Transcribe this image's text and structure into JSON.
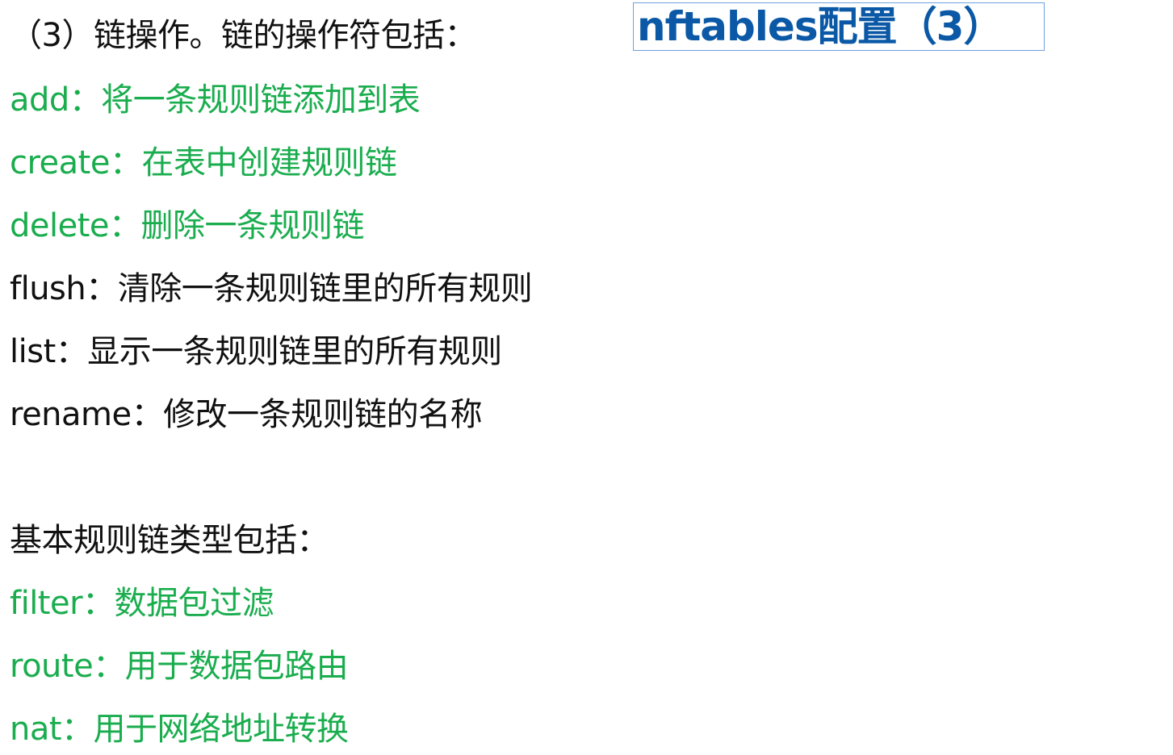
{
  "title": "nftables配置（3）",
  "lines": [
    {
      "text": "（3）链操作。链的操作符包括：",
      "color": "black"
    },
    {
      "text": "add：将一条规则链添加到表",
      "color": "green"
    },
    {
      "text": "create：在表中创建规则链",
      "color": "green"
    },
    {
      "text": "delete：删除一条规则链",
      "color": "green"
    },
    {
      "text": "flush：清除一条规则链里的所有规则",
      "color": "black"
    },
    {
      "text": "list：显示一条规则链里的所有规则",
      "color": "black"
    },
    {
      "text": "rename：修改一条规则链的名称",
      "color": "black"
    },
    {
      "text": "基本规则链类型包括：",
      "color": "black"
    },
    {
      "text": "filter：数据包过滤",
      "color": "green"
    },
    {
      "text": "route：用于数据包路由",
      "color": "green"
    },
    {
      "text": "nat：用于网络地址转换",
      "color": "green"
    }
  ],
  "colors": {
    "title": "#0b59a6",
    "green": "#1aad4e",
    "black": "#111111",
    "title_border": "#6fa0dc"
  }
}
